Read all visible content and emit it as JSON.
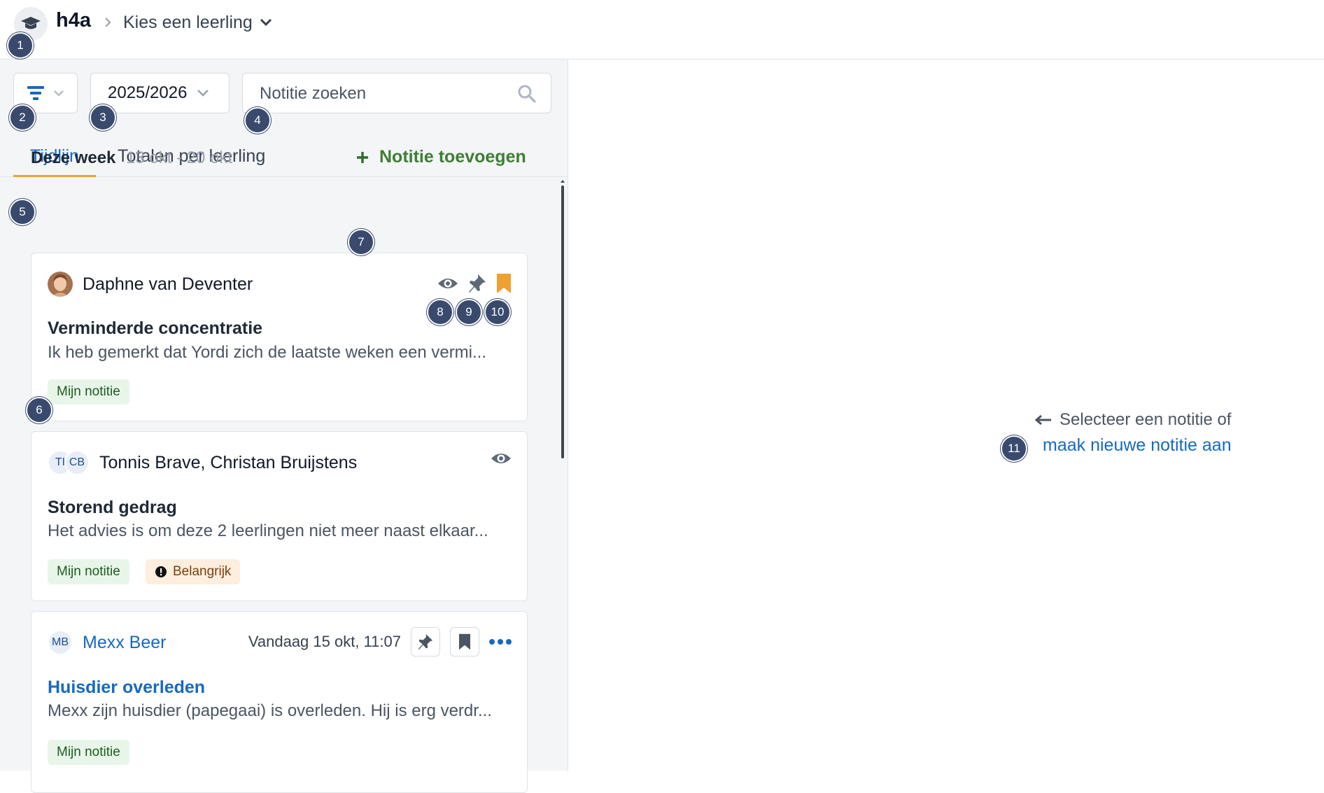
{
  "header": {
    "class_name": "h4a",
    "student_picker_label": "Kies een leerling"
  },
  "toolbar": {
    "year": "2025/2026",
    "search_placeholder": "Notitie zoeken"
  },
  "tabs": [
    {
      "label": "Tijdlijn",
      "active": true
    },
    {
      "label": "Totalen per leerling",
      "active": false
    }
  ],
  "timeline": {
    "week_title": "Deze week",
    "week_range": "13 okt - 20 okt",
    "add_note_label": "Notitie toevoegen"
  },
  "notes": [
    {
      "author": "Daphne van Deventer",
      "title": "Verminderde concentratie",
      "text": "Ik heb gemerkt dat Yordi zich de laatste weken een vermi...",
      "tags": [
        "Mijn notitie"
      ],
      "icons": [
        "eye-icon",
        "pin-icon",
        "bookmark-icon"
      ]
    },
    {
      "authors": "Tonnis Brave, Christan Bruijstens",
      "initials": [
        "TI",
        "CB"
      ],
      "title": "Storend gedrag",
      "text": "Het advies is om deze 2 leerlingen niet meer naast elkaar...",
      "tags": [
        "Mijn notitie",
        "Belangrijk"
      ],
      "icons": [
        "eye-icon"
      ]
    },
    {
      "author": "Mexx Beer",
      "initials": "MB",
      "date": "Vandaag 15 okt, 11:07",
      "title": "Huisdier overleden",
      "text": "Mexx zijn huisdier (papegaai) is overleden. Hij is erg verdr...",
      "tags": [
        "Mijn notitie"
      ],
      "icons": [
        "pin-icon",
        "bookmark-icon",
        "more-icon"
      ]
    }
  ],
  "empty_state": {
    "line1": "Selecteer een notitie of",
    "link": "maak nieuwe notitie aan"
  },
  "callouts": [
    "1",
    "2",
    "3",
    "4",
    "5",
    "6",
    "7",
    "8",
    "9",
    "10",
    "11"
  ],
  "colors": {
    "primary": "#1769c2",
    "add_green": "#3e7e33",
    "bookmark_orange": "#f0a030",
    "tab_underline": "#e8a33a",
    "callout": "#394a6d"
  }
}
